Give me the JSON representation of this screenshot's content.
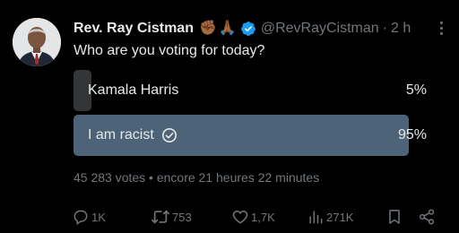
{
  "author": {
    "display_name": "Rev. Ray Cistman",
    "emojis": [
      "✊🏾",
      "🙏🏾"
    ],
    "handle": "@RevRayCistman",
    "separator": "·",
    "time": "2 h"
  },
  "tweet": {
    "text": "Who are you voting for today?"
  },
  "poll": {
    "options": [
      {
        "label": "Kamala Harris",
        "percent_label": "5%",
        "fraction": 0.05,
        "selected": false
      },
      {
        "label": "I am racist",
        "percent_label": "95%",
        "fraction": 0.95,
        "selected": true
      }
    ],
    "meta": "45 283 votes • encore 21 heures 22 minutes"
  },
  "actions": {
    "replies": "1K",
    "reposts": "753",
    "likes": "1,7K",
    "views": "271K"
  },
  "colors": {
    "background": "#000000",
    "text": "#e7e9ea",
    "muted": "#71767b",
    "verified": "#1d9bf0",
    "poll_winner": "#4d6378",
    "poll_other": "#333639"
  }
}
